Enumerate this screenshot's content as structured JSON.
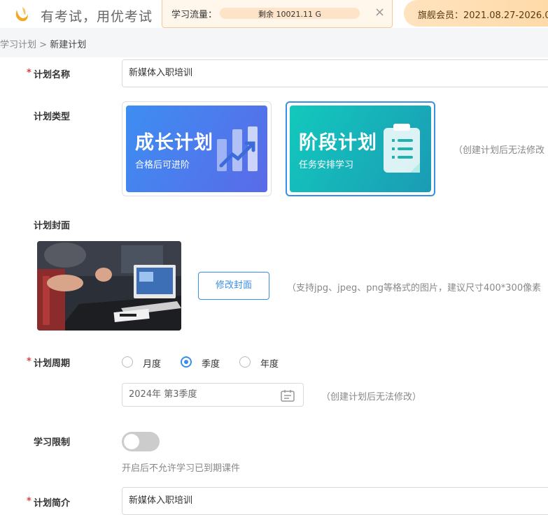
{
  "header": {
    "slogan": "有考试，用优考试",
    "flow_label": "学习流量：",
    "flow_remaining": "剩余 10021.11 G",
    "close_symbol": "×",
    "vip_text": "旗舰会员：2021.08.27-2026.0"
  },
  "breadcrumb": {
    "parent": "学习计划",
    "separator": ">",
    "current": "新建计划"
  },
  "form": {
    "name": {
      "required_mark": "*",
      "label": "计划名称",
      "value": "新媒体入职培训"
    },
    "type": {
      "label": "计划类型",
      "options": [
        {
          "title": "成长计划",
          "subtitle": "合格后可进阶",
          "selected": false
        },
        {
          "title": "阶段计划",
          "subtitle": "任务安排学习",
          "selected": true
        }
      ],
      "hint": "（创建计划后无法修改"
    },
    "cover": {
      "label": "计划封面",
      "button_label": "修改封面",
      "hint": "（支持jpg、jpeg、png等格式的图片，建议尺寸400*300像素"
    },
    "cycle": {
      "required_mark": "*",
      "label": "计划周期",
      "options": [
        {
          "label": "月度",
          "selected": false
        },
        {
          "label": "季度",
          "selected": true
        },
        {
          "label": "年度",
          "selected": false
        }
      ],
      "date_value": "2024年 第3季度",
      "hint": "（创建计划后无法修改）"
    },
    "limit": {
      "label": "学习限制",
      "enabled": false,
      "description": "开启后不允许学习已到期课件"
    },
    "intro": {
      "required_mark": "*",
      "label": "计划简介",
      "value": "新媒体入职培训"
    }
  },
  "colors": {
    "accent": "#3a8ee6",
    "required": "#e34040",
    "growth_card_start": "#3d8ef2",
    "growth_card_end": "#5a6ae8",
    "stage_card_start": "#12c9bd",
    "stage_card_end": "#1b9bb5"
  }
}
